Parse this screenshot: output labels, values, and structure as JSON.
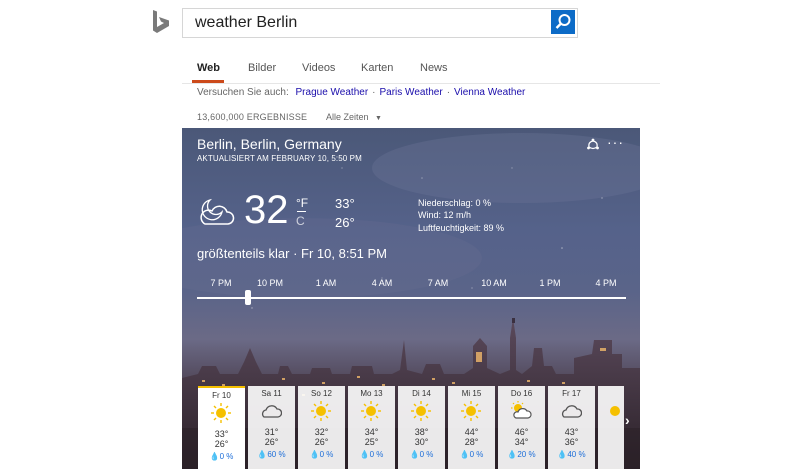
{
  "search": {
    "query": "weather Berlin"
  },
  "tabs": [
    {
      "label": "Web"
    },
    {
      "label": "Bilder"
    },
    {
      "label": "Videos"
    },
    {
      "label": "Karten"
    },
    {
      "label": "News"
    }
  ],
  "suggestions": {
    "prefix": "Versuchen Sie auch:",
    "items": [
      "Prague Weather",
      "Paris Weather",
      "Vienna Weather"
    ]
  },
  "results": {
    "count": "13,600,000 ERGEBNISSE",
    "time_filter": "Alle Zeiten"
  },
  "weather": {
    "location": "Berlin, Berlin, Germany",
    "updated": "AKTUALISIERT AM FEBRUARY 10, 5:50 PM",
    "temp": "32",
    "unit_f": "°F",
    "unit_c": "C",
    "high": "33°",
    "low": "26°",
    "precip": "Niederschlag: 0 %",
    "wind": "Wind: 12 m/h",
    "humidity": "Luftfeuchtigkeit: 89 %",
    "condition": "größtenteils klar · Fr 10, 8:51 PM",
    "hours": [
      "7 PM",
      "10 PM",
      "1 AM",
      "4 AM",
      "7 AM",
      "10 AM",
      "1 PM",
      "4 PM"
    ],
    "slider_position": 0.12,
    "forecast": [
      {
        "day": "Fr 10",
        "icon": "sun-icon",
        "hi": "33°",
        "lo": "26°",
        "precip": "0 %"
      },
      {
        "day": "Sa 11",
        "icon": "cloud-icon",
        "hi": "31°",
        "lo": "26°",
        "precip": "60 %"
      },
      {
        "day": "So 12",
        "icon": "sun-icon",
        "hi": "32°",
        "lo": "26°",
        "precip": "0 %"
      },
      {
        "day": "Mo 13",
        "icon": "sun-icon",
        "hi": "34°",
        "lo": "25°",
        "precip": "0 %"
      },
      {
        "day": "Di 14",
        "icon": "sun-icon",
        "hi": "38°",
        "lo": "30°",
        "precip": "0 %"
      },
      {
        "day": "Mi 15",
        "icon": "sun-icon",
        "hi": "44°",
        "lo": "28°",
        "precip": "0 %"
      },
      {
        "day": "Do 16",
        "icon": "partly-cloudy-icon",
        "hi": "46°",
        "lo": "34°",
        "precip": "20 %"
      },
      {
        "day": "Fr 17",
        "icon": "cloud-icon",
        "hi": "43°",
        "lo": "36°",
        "precip": "40 %"
      }
    ]
  },
  "colors": {
    "accent": "#cc4a1b",
    "link": "#1a0dab",
    "search_button": "#0c6bc7",
    "active_day": "#f5c000"
  }
}
